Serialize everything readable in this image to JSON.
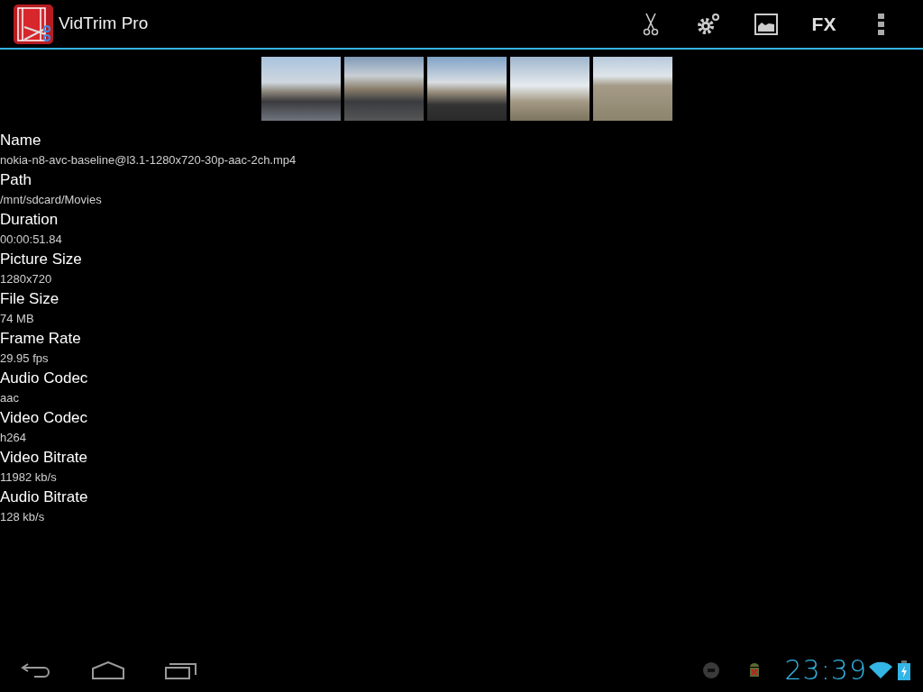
{
  "app_bar": {
    "title": "VidTrim Pro",
    "actions": [
      {
        "kind": "scissors"
      },
      {
        "kind": "settings"
      },
      {
        "kind": "image"
      },
      {
        "kind": "text",
        "label": "FX"
      },
      {
        "kind": "overflow"
      }
    ]
  },
  "thumbnails": [
    {
      "kind": "frame"
    },
    {
      "kind": "frame"
    },
    {
      "kind": "frame"
    },
    {
      "kind": "frame"
    },
    {
      "kind": "frame"
    }
  ],
  "properties": [
    {
      "label": "Name",
      "value": "nokia-n8-avc-baseline@l3.1-1280x720-30p-aac-2ch.mp4"
    },
    {
      "label": "Path",
      "value": "/mnt/sdcard/Movies"
    },
    {
      "label": "Duration",
      "value": "00:00:51.84"
    },
    {
      "label": "Picture Size",
      "value": "1280x720"
    },
    {
      "label": "File Size",
      "value": "74 MB"
    },
    {
      "label": "Frame Rate",
      "value": "29.95 fps"
    },
    {
      "label": "Audio Codec",
      "value": "aac"
    },
    {
      "label": "Video Codec",
      "value": "h264"
    },
    {
      "label": "Video Bitrate",
      "value": "11982 kb/s"
    },
    {
      "label": "Audio Bitrate",
      "value": "128 kb/s"
    }
  ],
  "system_bar": {
    "time": "23:39"
  }
}
